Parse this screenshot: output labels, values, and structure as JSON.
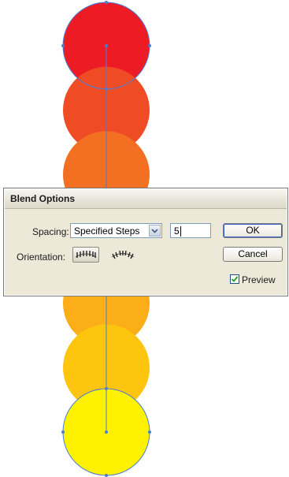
{
  "dialog": {
    "title": "Blend Options",
    "spacing_label": "Spacing:",
    "spacing_value": "Specified Steps",
    "steps_value": "5",
    "orientation_label": "Orientation:",
    "ok_label": "OK",
    "cancel_label": "Cancel",
    "preview_label": "Preview",
    "preview_checked": true
  },
  "artwork": {
    "circle_colors": [
      "#ed1c24",
      "#ef4b24",
      "#f36f21",
      "#f7941d",
      "#fbae17",
      "#fdc50d",
      "#fff200"
    ],
    "path_color": "#4a7bd6"
  }
}
